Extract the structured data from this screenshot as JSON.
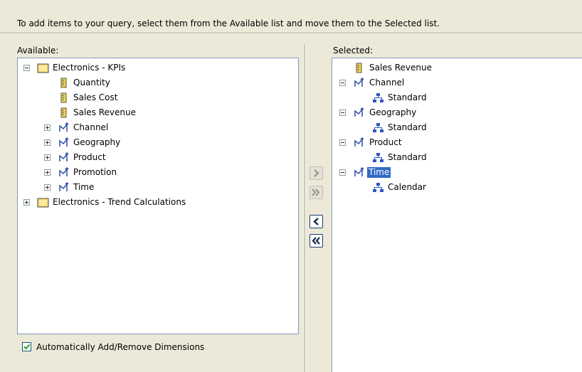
{
  "instructions": "To add items to your query, select them from the Available list and move them to the Selected list.",
  "available": {
    "label": "Available:",
    "items": [
      {
        "label": "Electronics - KPIs",
        "icon": "folder-icon",
        "expander": "minus"
      },
      {
        "label": "Quantity",
        "icon": "measure-icon"
      },
      {
        "label": "Sales Cost",
        "icon": "measure-icon"
      },
      {
        "label": "Sales Revenue",
        "icon": "measure-icon"
      },
      {
        "label": "Channel",
        "icon": "dimension-icon",
        "expander": "plus"
      },
      {
        "label": "Geography",
        "icon": "dimension-icon",
        "expander": "plus"
      },
      {
        "label": "Product",
        "icon": "dimension-icon",
        "expander": "plus"
      },
      {
        "label": "Promotion",
        "icon": "dimension-icon",
        "expander": "plus"
      },
      {
        "label": "Time",
        "icon": "dimension-icon",
        "expander": "plus"
      },
      {
        "label": "Electronics - Trend Calculations",
        "icon": "folder-icon",
        "expander": "plus"
      }
    ]
  },
  "selected": {
    "label": "Selected:",
    "items": [
      {
        "label": "Sales Revenue",
        "icon": "measure-icon"
      },
      {
        "label": "Channel",
        "icon": "dimension-icon",
        "expander": "minus"
      },
      {
        "label": "Standard",
        "icon": "hierarchy-icon"
      },
      {
        "label": "Geography",
        "icon": "dimension-icon",
        "expander": "minus"
      },
      {
        "label": "Standard",
        "icon": "hierarchy-icon"
      },
      {
        "label": "Product",
        "icon": "dimension-icon",
        "expander": "minus"
      },
      {
        "label": "Standard",
        "icon": "hierarchy-icon"
      },
      {
        "label": "Time",
        "icon": "dimension-icon",
        "expander": "minus",
        "selected": true
      },
      {
        "label": "Calendar",
        "icon": "hierarchy-icon"
      }
    ]
  },
  "buttons": {
    "add": {
      "glyph": "›",
      "enabled": false
    },
    "add_all": {
      "glyph": "»",
      "enabled": false
    },
    "remove": {
      "glyph": "‹",
      "enabled": true
    },
    "remove_all": {
      "glyph": "«",
      "enabled": true
    }
  },
  "auto_dimensions": {
    "label": "Automatically Add/Remove Dimensions",
    "checked": true
  },
  "colors": {
    "selection": "#316ac5",
    "folder": "#f6d86b",
    "dimension": "#2c4fa8",
    "hierarchy": "#2f55c4"
  }
}
